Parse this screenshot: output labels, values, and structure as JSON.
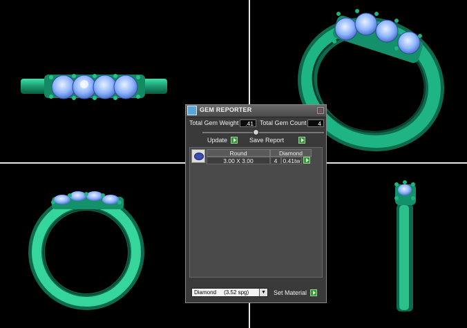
{
  "panel": {
    "title": "GEM REPORTER",
    "close_glyph": "x",
    "total_weight_label": "Total Gem Weight",
    "total_weight_value": ".41",
    "total_count_label": "Total Gem Count",
    "total_count_value": "4",
    "update_label": "Update",
    "save_report_label": "Save Report",
    "table": {
      "headers": [
        "Round",
        "Diamond"
      ],
      "rows": [
        {
          "size": "3.00 X 3.00",
          "count": "4",
          "weight": "0.41tw"
        }
      ]
    },
    "material_select": "Diamond     (3.52 spg)",
    "set_material_label": "Set Material"
  },
  "colors": {
    "metal": "#1fa47c",
    "gem": "#8fb6ff",
    "background": "#000000"
  }
}
